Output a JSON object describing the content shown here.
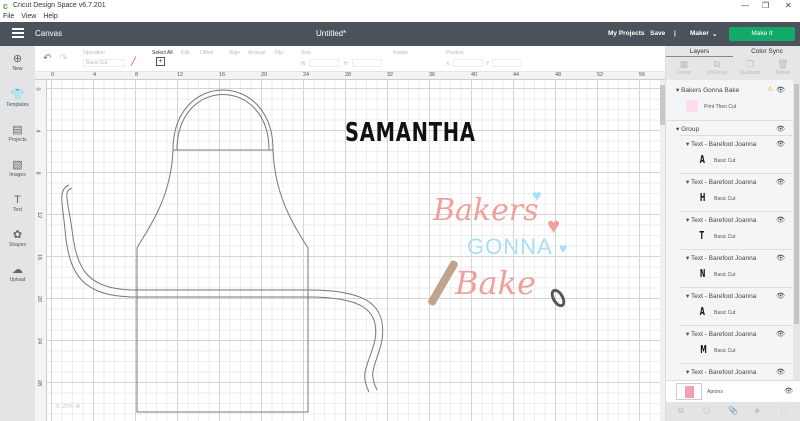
{
  "app": {
    "title": "Cricut Design Space  v6.7.201",
    "menu": [
      "File",
      "View",
      "Help"
    ],
    "window_controls": [
      "—",
      "❐",
      "✕"
    ]
  },
  "header": {
    "section": "Canvas",
    "document": "Untitled*",
    "my_projects": "My Projects",
    "save": "Save",
    "separator": "|",
    "machine": "Maker",
    "make_it": "Make It"
  },
  "toolbar": {
    "operation_label": "Operation",
    "operation_value": "Basic Cut",
    "select_all": "Select All",
    "edit": "Edit",
    "offset": "Offset",
    "align": "Align",
    "arrange": "Arrange",
    "flip": "Flip",
    "size": "Size",
    "w": "W",
    "h": "H",
    "rotate": "Rotate",
    "position": "Position",
    "x": "X",
    "y": "Y"
  },
  "sidebar": [
    {
      "label": "New",
      "icon": "⊕"
    },
    {
      "label": "Templates",
      "icon": "👕"
    },
    {
      "label": "Projects",
      "icon": "▤"
    },
    {
      "label": "Images",
      "icon": "▧"
    },
    {
      "label": "Text",
      "icon": "T"
    },
    {
      "label": "Shapes",
      "icon": "✿"
    },
    {
      "label": "Upload",
      "icon": "☁"
    }
  ],
  "ruler": {
    "top": [
      "0",
      "4",
      "8",
      "12",
      "16",
      "20",
      "24",
      "28",
      "32",
      "36",
      "40",
      "44",
      "48",
      "52",
      "56"
    ],
    "left": [
      "0",
      "4",
      "8",
      "12",
      "16",
      "20",
      "24",
      "28"
    ]
  },
  "canvas": {
    "name_text": "SAMANTHA",
    "design": {
      "line1": "Bakers",
      "line2": "GONNA",
      "line3": "Bake"
    },
    "zoom": "25%"
  },
  "panel": {
    "tabs": [
      "Layers",
      "Color Sync"
    ],
    "tools": [
      "Group",
      "UnGroup",
      "Duplicate",
      "Delete"
    ],
    "layers": {
      "top": {
        "name": "Bakers Gonna Bake",
        "op": "Print Then Cut"
      },
      "group": "Group",
      "texts": [
        {
          "name": "Text - Barefoot Joanna",
          "glyph": "A",
          "op": "Basic Cut"
        },
        {
          "name": "Text - Barefoot Joanna",
          "glyph": "H",
          "op": "Basic Cut"
        },
        {
          "name": "Text - Barefoot Joanna",
          "glyph": "T",
          "op": "Basic Cut"
        },
        {
          "name": "Text - Barefoot Joanna",
          "glyph": "N",
          "op": "Basic Cut"
        },
        {
          "name": "Text - Barefoot Joanna",
          "glyph": "A",
          "op": "Basic Cut"
        },
        {
          "name": "Text - Barefoot Joanna",
          "glyph": "M",
          "op": "Basic Cut"
        },
        {
          "name": "Text - Barefoot Joanna",
          "glyph": "",
          "op": ""
        }
      ]
    },
    "blank": "Aprons"
  },
  "colors": {
    "header": "#4a535b",
    "make_it": "#13a96b",
    "pink": "#f0a09c",
    "blue": "#a8e0f5",
    "brown": "#bfa38d",
    "gray": "#555555"
  }
}
